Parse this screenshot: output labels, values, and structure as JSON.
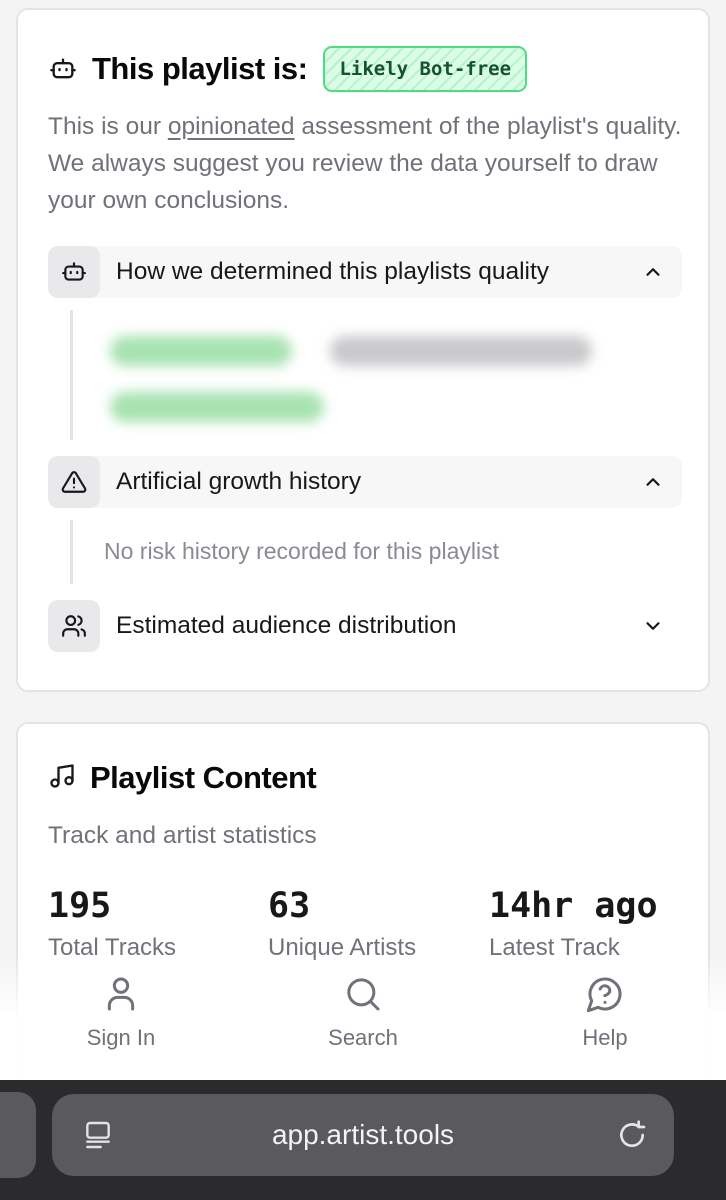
{
  "quality_card": {
    "title": "This playlist is:",
    "badge": "Likely Bot-free",
    "description_pre": "This is our ",
    "description_link": "opinionated",
    "description_post": " assessment of the playlist's quality. We always suggest you review the data yourself to draw your own conclusions.",
    "sections": [
      {
        "label": "How we determined this playlists quality",
        "icon": "robot-icon",
        "state": "expanded"
      },
      {
        "label": "Artificial growth history",
        "icon": "warning-icon",
        "state": "expanded",
        "content": "No risk history recorded for this playlist"
      },
      {
        "label": "Estimated audience distribution",
        "icon": "users-icon",
        "state": "collapsed"
      }
    ]
  },
  "content_card": {
    "title": "Playlist Content",
    "subtitle": "Track and artist statistics",
    "stats": [
      {
        "value": "195",
        "label": "Total Tracks"
      },
      {
        "value": "63",
        "label": "Unique Artists"
      },
      {
        "value": "14hr ago",
        "label": "Latest Track"
      }
    ]
  },
  "bottom_nav": [
    {
      "label": "Sign In",
      "icon": "user-icon"
    },
    {
      "label": "Search",
      "icon": "search-icon"
    },
    {
      "label": "Help",
      "icon": "help-chat-icon"
    }
  ],
  "browser": {
    "url": "app.artist.tools"
  },
  "colors": {
    "badge_border": "#4ade80",
    "badge_bg": "#dcfce7",
    "badge_text": "#14532d",
    "muted_text": "#71717a"
  }
}
